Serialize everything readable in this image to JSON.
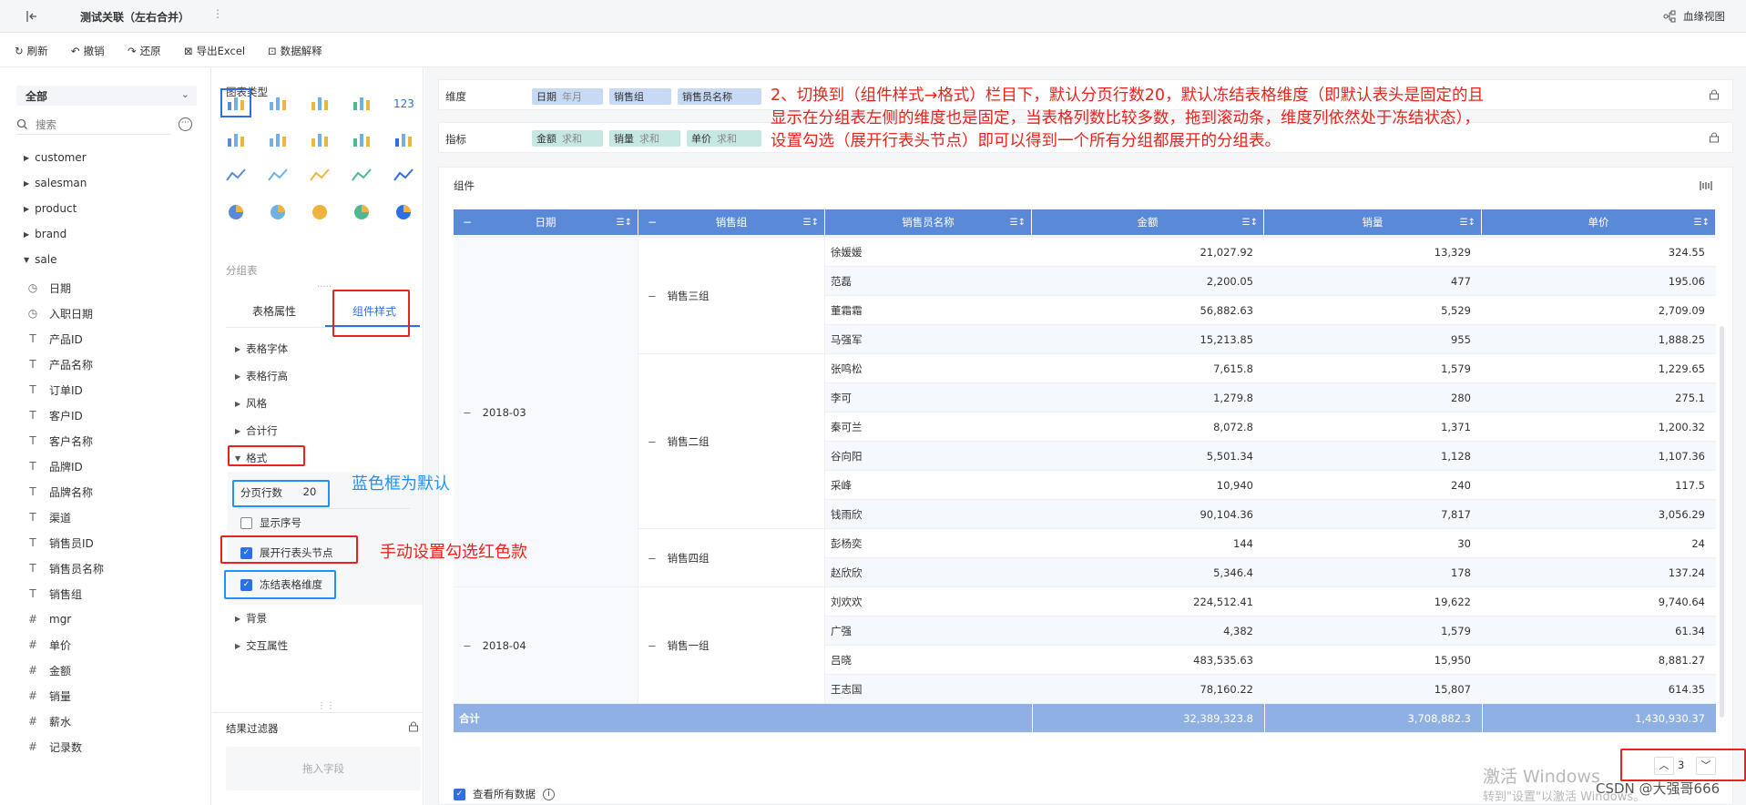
{
  "header": {
    "title": "测试关联（左右合并）",
    "lineage": "血缘视图"
  },
  "toolbar": {
    "refresh": "刷新",
    "undo": "撤销",
    "redo": "还原",
    "export": "导出Excel",
    "interpret": "数据解释"
  },
  "fields": {
    "scope": "全部",
    "search_placeholder": "搜索",
    "tables": [
      "customer",
      "salesman",
      "product",
      "brand",
      "sale"
    ],
    "items": [
      {
        "icon": "clock-icon",
        "label": "日期"
      },
      {
        "icon": "clock-icon",
        "label": "入职日期"
      },
      {
        "icon": "text-icon",
        "label": "产品ID"
      },
      {
        "icon": "text-icon",
        "label": "产品名称"
      },
      {
        "icon": "text-icon",
        "label": "订单ID"
      },
      {
        "icon": "text-icon",
        "label": "客户ID"
      },
      {
        "icon": "text-icon",
        "label": "客户名称"
      },
      {
        "icon": "text-icon",
        "label": "品牌ID"
      },
      {
        "icon": "text-icon",
        "label": "品牌名称"
      },
      {
        "icon": "text-icon",
        "label": "渠道"
      },
      {
        "icon": "text-icon",
        "label": "销售员ID"
      },
      {
        "icon": "text-icon",
        "label": "销售员名称"
      },
      {
        "icon": "text-icon",
        "label": "销售组"
      },
      {
        "icon": "hash-icon",
        "label": "mgr"
      },
      {
        "icon": "hash-icon",
        "label": "单价"
      },
      {
        "icon": "hash-icon",
        "label": "金额"
      },
      {
        "icon": "hash-icon",
        "label": "销量"
      },
      {
        "icon": "hash-icon",
        "label": "薪水"
      },
      {
        "icon": "hash-icon",
        "label": "记录数"
      }
    ]
  },
  "config": {
    "chart_type_title": "图表类型",
    "chart_type_name": "分组表",
    "tab_table_props": "表格属性",
    "tab_component_style": "组件样式",
    "sections_top": [
      "表格字体",
      "表格行高",
      "风格",
      "合计行"
    ],
    "format_section": "格式",
    "page_rows_label": "分页行数",
    "page_rows_value": "20",
    "show_index": "显示序号",
    "expand_header": "展开行表头节点",
    "freeze_dims": "冻结表格维度",
    "sections_bottom": [
      "背景",
      "交互属性"
    ],
    "filter_title": "结果过滤器",
    "filter_drop": "拖入字段"
  },
  "shelf": {
    "dim_label": "维度",
    "dims": [
      {
        "name": "日期",
        "sub": "年月"
      },
      {
        "name": "销售组",
        "sub": ""
      },
      {
        "name": "销售员名称",
        "sub": ""
      }
    ],
    "metric_label": "指标",
    "metrics": [
      {
        "name": "金额",
        "sub": "求和"
      },
      {
        "name": "销量",
        "sub": "求和"
      },
      {
        "name": "单价",
        "sub": "求和"
      }
    ]
  },
  "component": {
    "title": "组件"
  },
  "annotations": {
    "main_note_1": "2、切换到（组件样式→格式）栏目下，默认分页行数20，默认冻结表格维度（即默认表头是固定的且",
    "main_note_2": "显示在分组表左侧的维度也是固定，当表格列数比较多数，拖到滚动条，维度列依然处于冻结状态），",
    "main_note_3": "设置勾选（展开行表头节点）即可以得到一个所有分组都展开的分组表。",
    "blue_note": "蓝色框为默认",
    "red_note": "手动设置勾选红色款"
  },
  "table": {
    "headers": [
      "日期",
      "销售组",
      "销售员名称",
      "金额",
      "销量",
      "单价"
    ],
    "groups": [
      {
        "date": "2018-03",
        "groups": [
          {
            "name": "销售三组",
            "rows": [
              [
                "徐媛媛",
                "21,027.92",
                "13,329",
                "324.55"
              ],
              [
                "范磊",
                "2,200.05",
                "477",
                "195.06"
              ],
              [
                "董霜霜",
                "56,882.63",
                "5,529",
                "2,709.09"
              ],
              [
                "马强军",
                "15,213.85",
                "955",
                "1,888.25"
              ]
            ]
          },
          {
            "name": "销售二组",
            "rows": [
              [
                "张鸣松",
                "7,615.8",
                "1,579",
                "1,229.65"
              ],
              [
                "李可",
                "1,279.8",
                "280",
                "275.1"
              ],
              [
                "秦可兰",
                "8,072.8",
                "1,371",
                "1,200.32"
              ],
              [
                "谷向阳",
                "5,501.34",
                "1,128",
                "1,107.36"
              ],
              [
                "采峰",
                "10,940",
                "240",
                "117.5"
              ],
              [
                "钱雨欣",
                "90,104.36",
                "7,817",
                "3,056.29"
              ]
            ]
          },
          {
            "name": "销售四组",
            "rows": [
              [
                "彭杨奕",
                "144",
                "30",
                "24"
              ],
              [
                "赵欣欣",
                "5,346.4",
                "178",
                "137.24"
              ]
            ]
          }
        ]
      },
      {
        "date": "2018-04",
        "groups": [
          {
            "name": "销售一组",
            "rows": [
              [
                "刘欢欢",
                "224,512.41",
                "19,622",
                "9,740.64"
              ],
              [
                "广强",
                "4,382",
                "1,579",
                "61.34"
              ],
              [
                "吕晓",
                "483,535.63",
                "15,950",
                "8,881.27"
              ],
              [
                "王志国",
                "78,160.22",
                "15,807",
                "614.35"
              ]
            ]
          }
        ]
      }
    ],
    "total": {
      "label": "合计",
      "amount": "32,389,323.8",
      "qty": "3,708,882.3",
      "price": "1,430,930.37"
    }
  },
  "footer": {
    "view_all": "查看所有数据",
    "page": "3"
  },
  "watermark": {
    "line1": "激活 Windows",
    "line2": "转到\"设置\"以激活 Windows。",
    "credit": "CSDN @大强哥666"
  },
  "colors": {
    "accent": "#2f6fe4",
    "header_blue": "#5a8ad7",
    "annotation_red": "#e8231b",
    "annotation_blue": "#1e90ff"
  }
}
